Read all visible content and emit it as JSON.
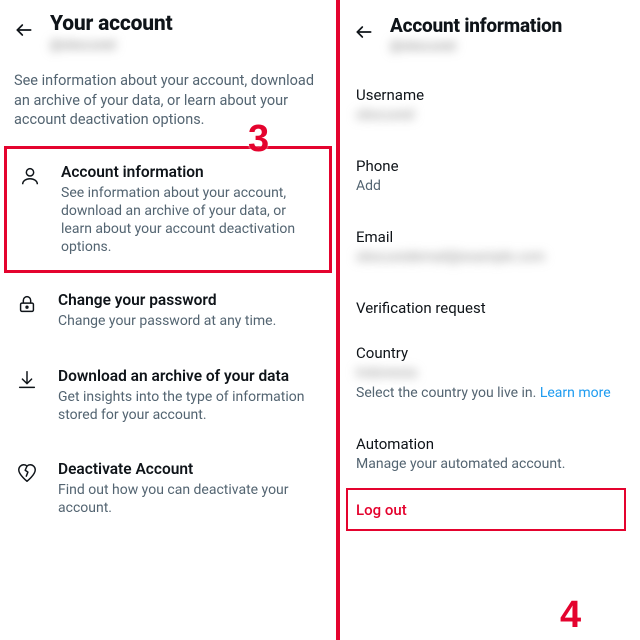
{
  "left": {
    "title": "Your account",
    "handle_blurred": "@obscured",
    "subdesc": "See information about your account, download an archive of your data, or learn about your account deactivation options.",
    "items": [
      {
        "title": "Account information",
        "desc": "See information about your account, download an archive of your data, or learn about your account deactivation options."
      },
      {
        "title": "Change your password",
        "desc": "Change your password at any time."
      },
      {
        "title": "Download an archive of your data",
        "desc": "Get insights into the type of information stored for your account."
      },
      {
        "title": "Deactivate Account",
        "desc": "Find out how you can deactivate your account."
      }
    ]
  },
  "right": {
    "title": "Account information",
    "handle_blurred": "@obscured",
    "username_label": "Username",
    "username_blurred": "obscured",
    "phone_label": "Phone",
    "phone_value": "Add",
    "email_label": "Email",
    "email_blurred": "obscuredemail@example.com",
    "verification_label": "Verification request",
    "country_label": "Country",
    "country_blurred": "Indonesia",
    "country_hint": "Select the country you live in. ",
    "learn_more": "Learn more",
    "automation_label": "Automation",
    "automation_hint": "Manage your automated account.",
    "logout": "Log out"
  },
  "badges": {
    "step3": "3",
    "step4": "4"
  },
  "colors": {
    "accent_red": "#e4032e",
    "link_blue": "#1d9bf0",
    "text_secondary": "#536471"
  }
}
